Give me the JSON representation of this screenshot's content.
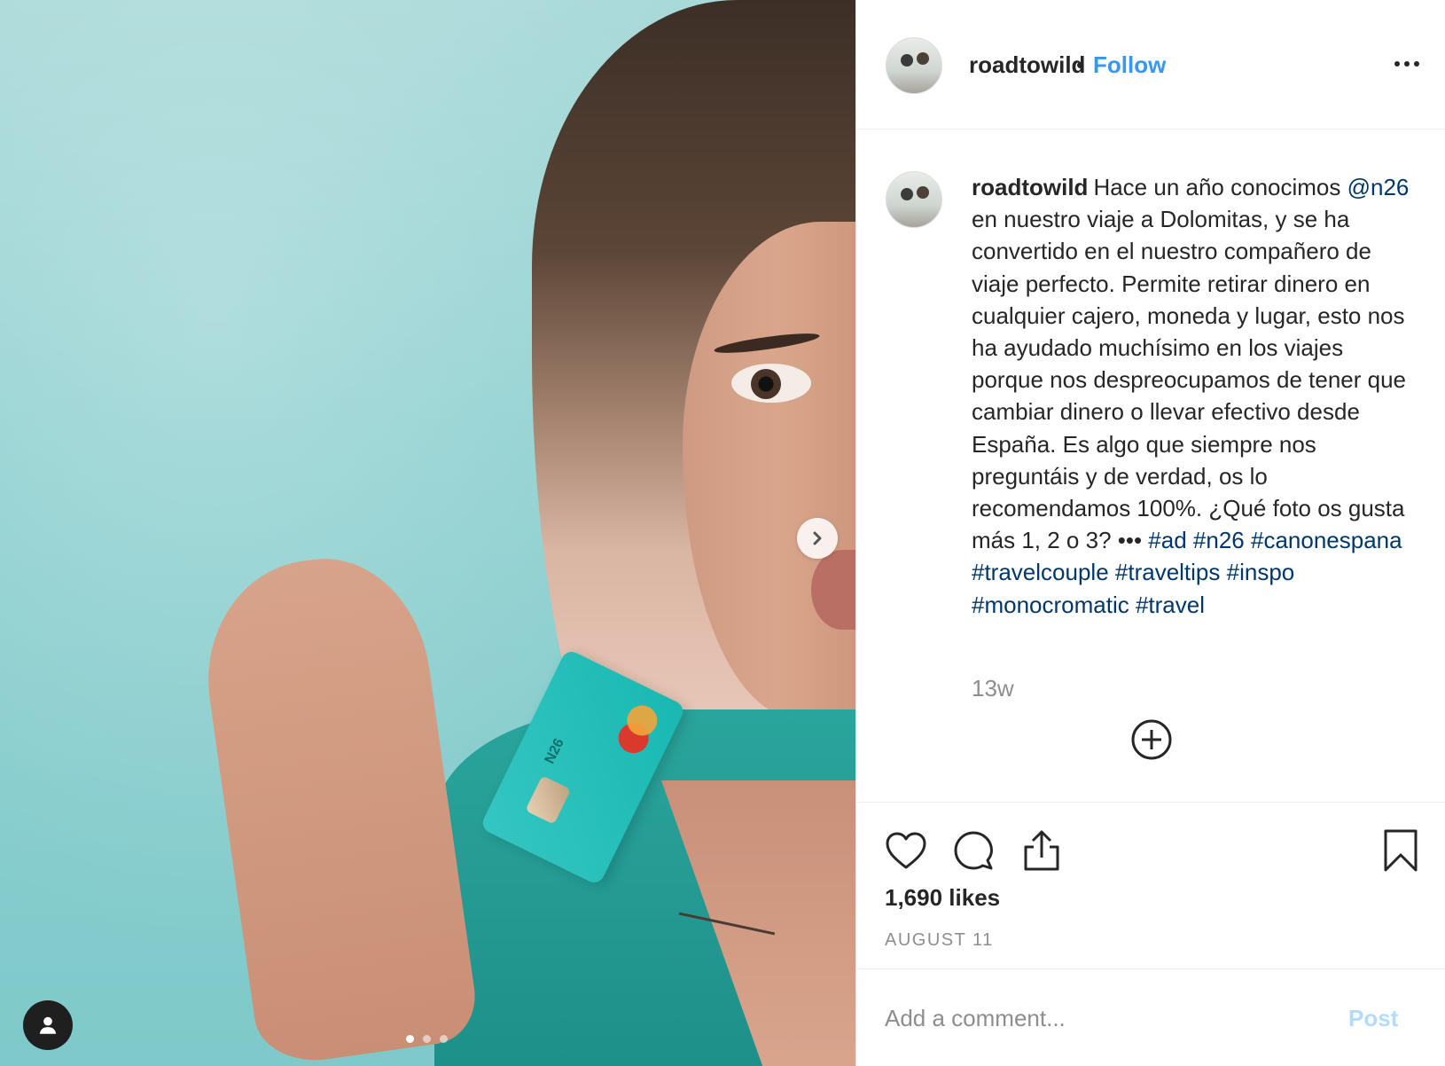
{
  "post": {
    "username": "roadtowild",
    "follow_label": "Follow",
    "separator": "•",
    "caption_segments": [
      {
        "text": "Hace un año conocimos ",
        "type": "text"
      },
      {
        "text": "@n26",
        "type": "mention"
      },
      {
        "text": " en nuestro viaje a Dolomitas, y se ha convertido en el nuestro compañero de viaje perfecto. Permite retirar dinero en cualquier cajero, moneda y lugar, esto nos ha ayudado muchísimo en los viajes porque nos despreocupamos de tener que cambiar dinero o llevar efectivo desde España. Es algo que siempre nos preguntáis y de verdad, os lo recomendamos 100%. ¿Qué foto os gusta más 1, 2 o 3? ••• ",
        "type": "text"
      },
      {
        "text": "#ad",
        "type": "hashtag"
      },
      {
        "text": " ",
        "type": "text"
      },
      {
        "text": "#n26",
        "type": "hashtag"
      },
      {
        "text": " ",
        "type": "text"
      },
      {
        "text": "#canonespana",
        "type": "hashtag"
      },
      {
        "text": " ",
        "type": "text"
      },
      {
        "text": "#travelcouple",
        "type": "hashtag"
      },
      {
        "text": " ",
        "type": "text"
      },
      {
        "text": "#traveltips",
        "type": "hashtag"
      },
      {
        "text": " ",
        "type": "text"
      },
      {
        "text": "#inspo",
        "type": "hashtag"
      },
      {
        "text": " ",
        "type": "text"
      },
      {
        "text": "#monocromatic",
        "type": "hashtag"
      },
      {
        "text": " ",
        "type": "text"
      },
      {
        "text": "#travel",
        "type": "hashtag"
      }
    ],
    "time_ago": "13w",
    "likes": "1,690 likes",
    "date": "AUGUST 11"
  },
  "card": {
    "brand": "N26"
  },
  "carousel": {
    "count": 3,
    "active_index": 0
  },
  "comment_box": {
    "placeholder": "Add a comment...",
    "post_label": "Post"
  },
  "icons": {
    "more": "more-options-icon",
    "next": "chevron-right-icon",
    "tag": "user-tag-icon",
    "load_more": "plus-circle-icon",
    "like": "heart-icon",
    "comment": "comment-bubble-icon",
    "share": "share-icon",
    "save": "bookmark-icon"
  },
  "colors": {
    "link": "#00376b",
    "follow": "#3897f0",
    "post_disabled": "#b3dbff",
    "muted": "#8e8e8e"
  }
}
